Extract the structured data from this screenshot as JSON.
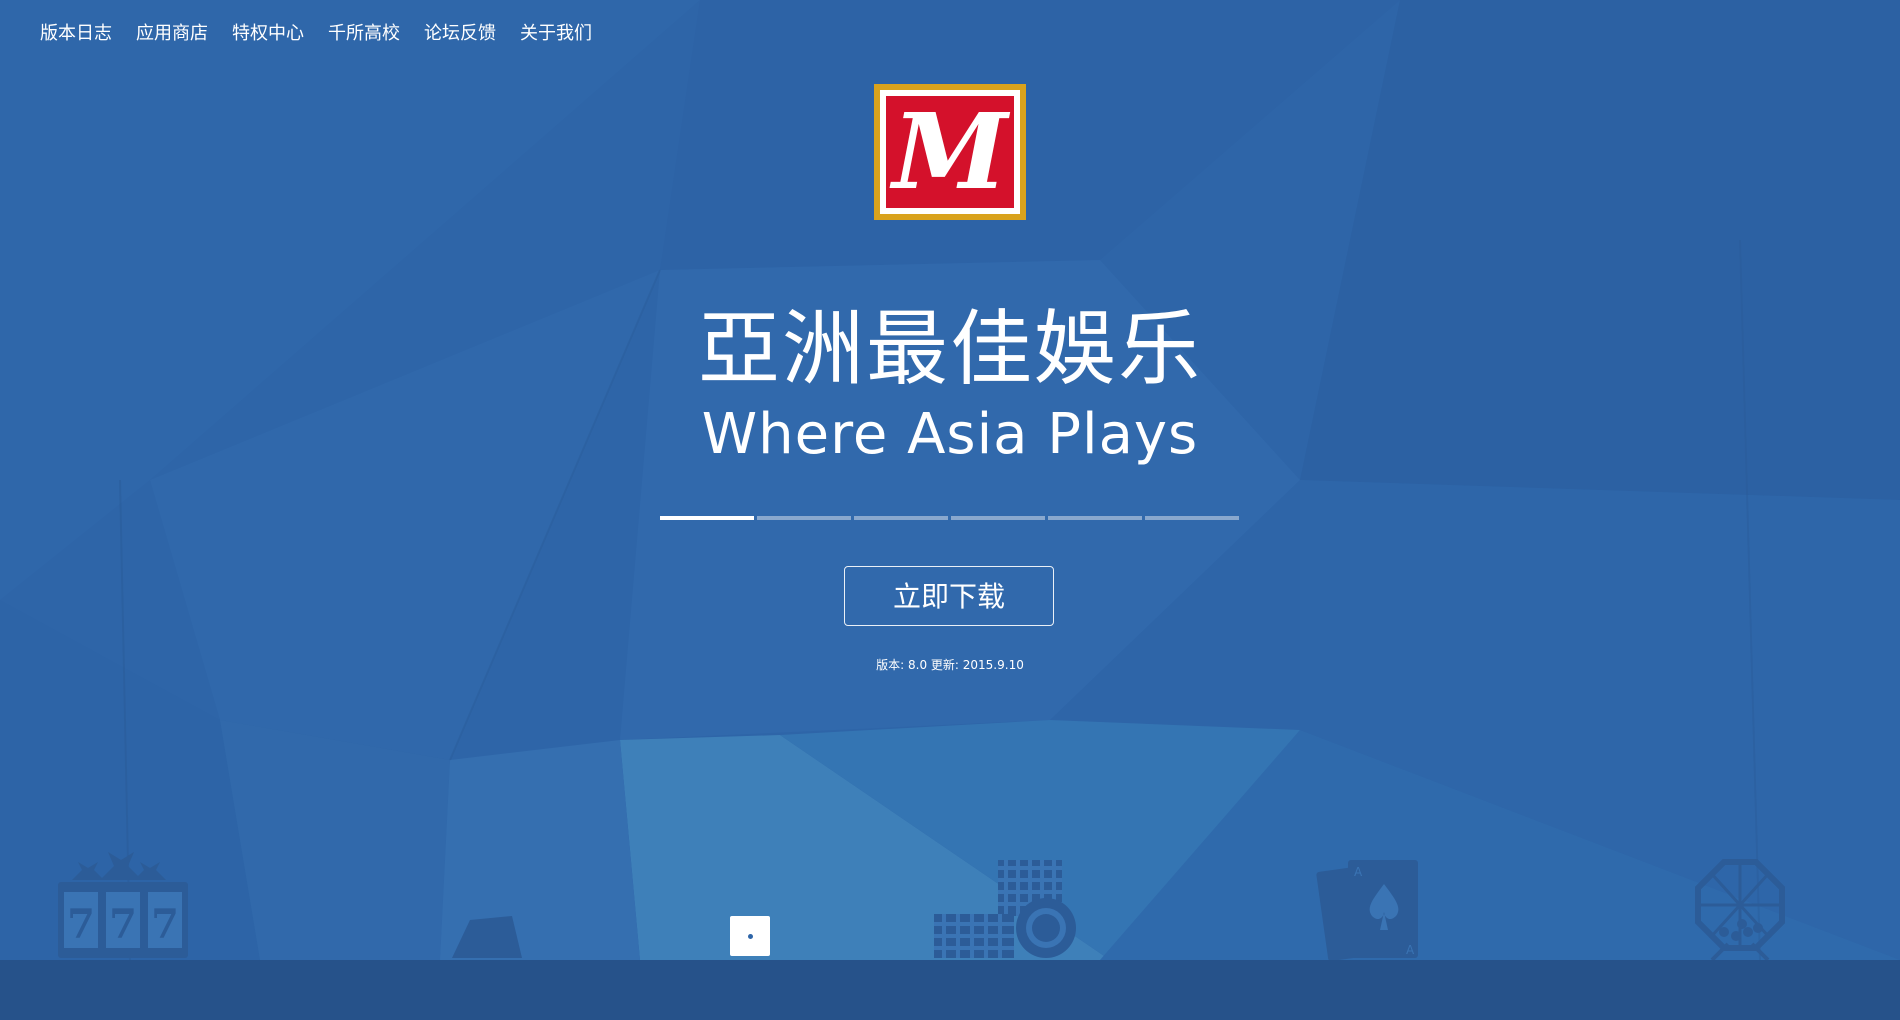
{
  "nav": {
    "items": [
      {
        "label": "版本日志"
      },
      {
        "label": "应用商店"
      },
      {
        "label": "特权中心"
      },
      {
        "label": "千所高校"
      },
      {
        "label": "论坛反馈"
      },
      {
        "label": "关于我们"
      }
    ]
  },
  "logo": {
    "letter": "M",
    "icon": "brand-logo-icon"
  },
  "hero": {
    "title_cn": "亞洲最佳娛乐",
    "title_en": "Where Asia Plays"
  },
  "carousel": {
    "slides": 6,
    "active": 1
  },
  "download": {
    "label": "立即下载"
  },
  "version": {
    "text": "版本: 8.0 更新: 2015.9.10"
  },
  "colors": {
    "background": "#2e65a8",
    "footer": "#26528a",
    "logo_red": "#d4112b",
    "logo_gold": "#d9a21c",
    "icon_shade": "#2c5c98"
  },
  "bottom_icons": [
    "slot-machine-icon",
    "card-shoe-icon",
    "chat-icon",
    "casino-chips-icon",
    "playing-cards-icon",
    "lottery-ball-icon"
  ]
}
